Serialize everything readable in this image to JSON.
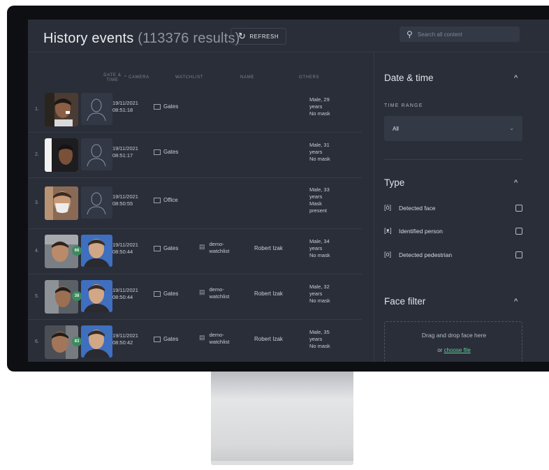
{
  "header": {
    "title": "History events",
    "count": "(113376 results)",
    "refresh_label": "REFRESH",
    "search_placeholder": "Search all content"
  },
  "columns": {
    "date_time": "DATE & TIME",
    "camera": "CAMERA",
    "watchlist": "WATCHLIST",
    "name": "NAME",
    "others": "OTHERS"
  },
  "rows": [
    {
      "num": "1.",
      "date": "19/11/2021",
      "time": "08:51:18",
      "camera": "Gates",
      "watchlist": "",
      "name": "",
      "others": [
        "Male, 29",
        "years",
        "No mask"
      ],
      "score": ""
    },
    {
      "num": "2.",
      "date": "19/11/2021",
      "time": "08:51:17",
      "camera": "Gates",
      "watchlist": "",
      "name": "",
      "others": [
        "Male, 31",
        "years",
        "No mask"
      ],
      "score": ""
    },
    {
      "num": "3.",
      "date": "19/11/2021",
      "time": "08:50:55",
      "camera": "Office",
      "watchlist": "",
      "name": "",
      "others": [
        "Male, 33",
        "years",
        "Mask",
        "present"
      ],
      "score": ""
    },
    {
      "num": "4.",
      "date": "19/11/2021",
      "time": "08:50:44",
      "camera": "Gates",
      "watchlist": [
        "demo-",
        "watchlist"
      ],
      "name": "Robert Izak",
      "others": [
        "Male, 34",
        "years",
        "No mask"
      ],
      "score": "66"
    },
    {
      "num": "5.",
      "date": "19/11/2021",
      "time": "08:50:44",
      "camera": "Gates",
      "watchlist": [
        "demo-",
        "watchlist"
      ],
      "name": "Robert Izak",
      "others": [
        "Male, 32",
        "years",
        "No mask"
      ],
      "score": "38"
    },
    {
      "num": "6.",
      "date": "19/11/2021",
      "time": "08:50:42",
      "camera": "Gates",
      "watchlist": [
        "demo-",
        "watchlist"
      ],
      "name": "Robert Izak",
      "others": [
        "Male, 35",
        "years",
        "No mask"
      ],
      "score": "83"
    }
  ],
  "sidebar": {
    "date_time": {
      "title": "Date & time",
      "time_range_label": "TIME RANGE",
      "time_range_value": "All"
    },
    "type": {
      "title": "Type",
      "items": [
        "Detected face",
        "Identified person",
        "Detected pedestrian"
      ]
    },
    "face_filter": {
      "title": "Face filter",
      "drop_text": "Drag and drop face here",
      "or_text": "or",
      "choose_file": "choose file"
    }
  },
  "colors": {
    "screen_bg": "#2a2e38",
    "accent_green": "#5fd0a0",
    "score_badge": "#3b8a5e",
    "watchlist_photo": "#3f6fbf"
  }
}
